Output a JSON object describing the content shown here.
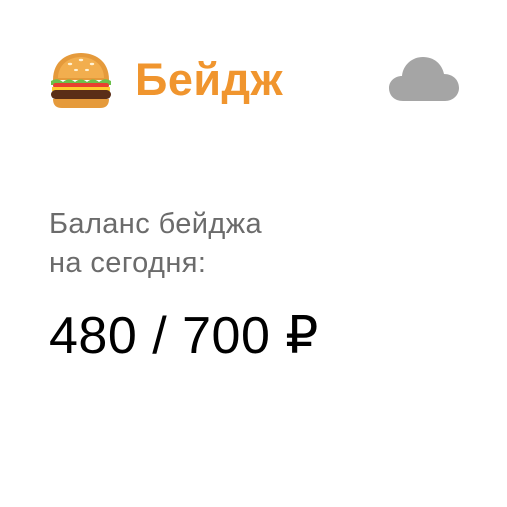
{
  "widget": {
    "title": "Бейдж",
    "title_color": "#f0952e",
    "leading_icon": "hamburger-icon",
    "trailing_icon": "cloud-icon",
    "cloud_color": "#a5a5a5",
    "caption_line1": "Баланс бейджа",
    "caption_line2": "на сегодня:",
    "balance": "480 / 700 ₽"
  }
}
